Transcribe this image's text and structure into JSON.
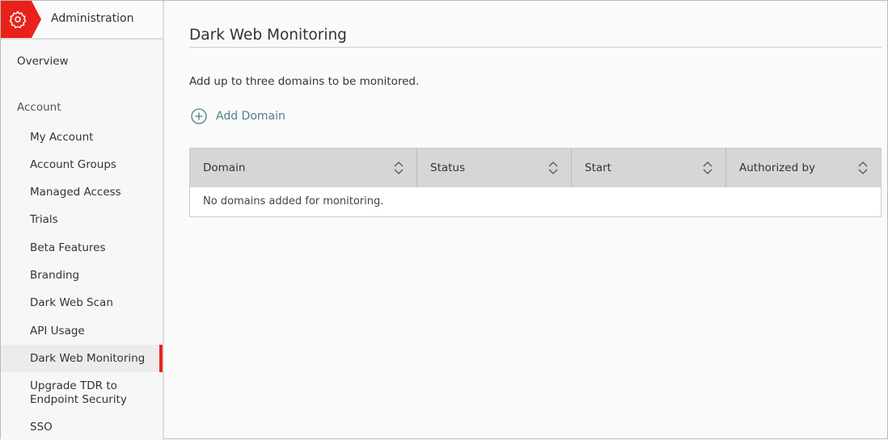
{
  "sidebar": {
    "header": "Administration",
    "overview": "Overview",
    "section": "Account",
    "items": [
      "My Account",
      "Account Groups",
      "Managed Access",
      "Trials",
      "Beta Features",
      "Branding",
      "Dark Web Scan",
      "API Usage",
      "Dark Web Monitoring",
      "Upgrade TDR to Endpoint Security",
      "SSO"
    ],
    "active": "Dark Web Monitoring"
  },
  "main": {
    "title": "Dark Web Monitoring",
    "description": "Add up to three domains to be monitored.",
    "add_domain": "Add Domain",
    "columns": [
      "Domain",
      "Status",
      "Start",
      "Authorized by"
    ],
    "empty": "No domains added for monitoring."
  },
  "colors": {
    "accent": "#e8221a",
    "link": "#4f7f8a"
  }
}
